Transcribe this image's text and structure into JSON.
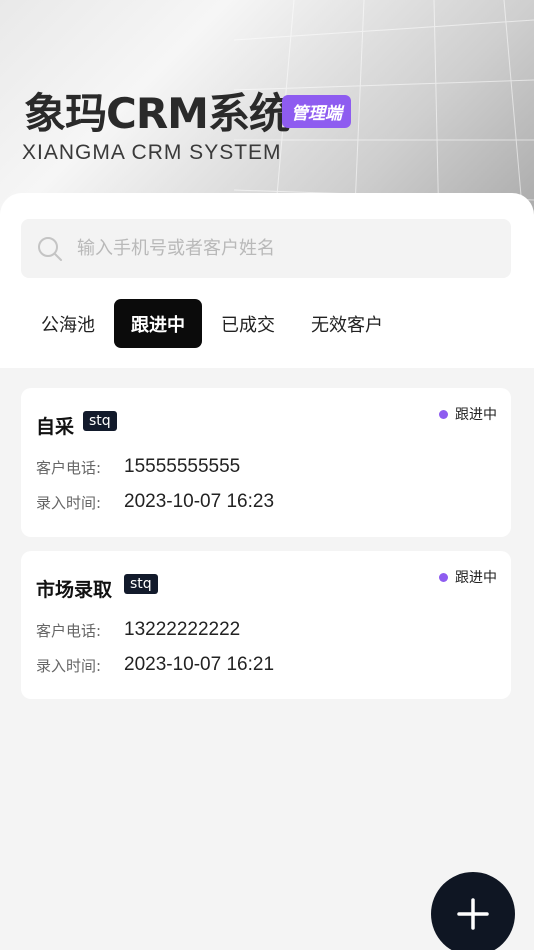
{
  "header": {
    "title": "象玛CRM系统",
    "badge": "管理端",
    "subtitle": "XIANGMA CRM SYSTEM"
  },
  "search": {
    "placeholder": "输入手机号或者客户姓名",
    "icon": "search-icon"
  },
  "tabs": [
    {
      "label": "公海池",
      "active": false
    },
    {
      "label": "跟进中",
      "active": true
    },
    {
      "label": "已成交",
      "active": false
    },
    {
      "label": "无效客户",
      "active": false
    }
  ],
  "customers": [
    {
      "name": "自采",
      "tag": "stq",
      "status": "跟进中",
      "phone_label": "客户电话:",
      "phone": "15555555555",
      "time_label": "录入时间:",
      "time": "2023-10-07 16:23"
    },
    {
      "name": "市场录取",
      "tag": "stq",
      "status": "跟进中",
      "phone_label": "客户电话:",
      "phone": "13222222222",
      "time_label": "录入时间:",
      "time": "2023-10-07 16:21"
    }
  ],
  "fab": {
    "icon": "plus-icon"
  },
  "colors": {
    "accent": "#8e5cf0",
    "dark": "#0f1623",
    "background": "#f4f4f4"
  }
}
